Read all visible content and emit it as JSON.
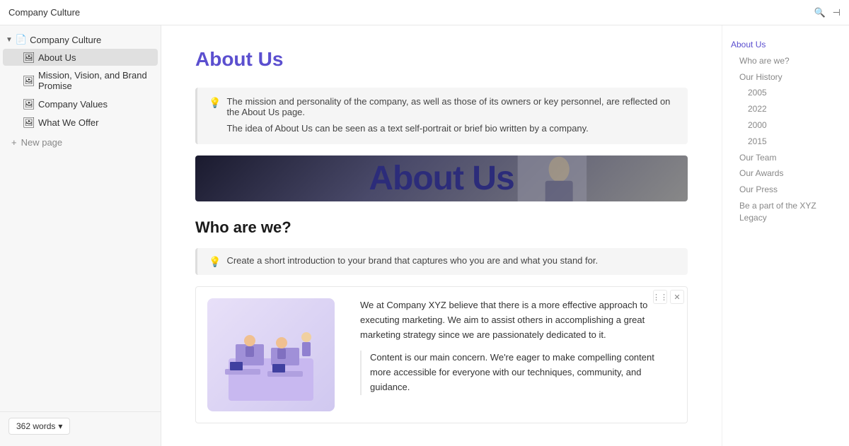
{
  "app": {
    "title": "Company Culture"
  },
  "topbar": {
    "title": "Company Culture",
    "search_icon": "🔍",
    "menu_icon": "≡"
  },
  "sidebar": {
    "root_label": "Company Culture",
    "items": [
      {
        "label": "About Us",
        "icon": "🖼",
        "active": true
      },
      {
        "label": "Mission, Vision, and Brand Promise",
        "icon": "🖼",
        "active": false
      },
      {
        "label": "Company Values",
        "icon": "🖼",
        "active": false
      },
      {
        "label": "What We Offer",
        "icon": "🖼",
        "active": false
      }
    ],
    "new_page_label": "New page",
    "word_count": "362 words"
  },
  "toc": {
    "items": [
      {
        "label": "About Us",
        "active": true,
        "indent": 0
      },
      {
        "label": "Who are we?",
        "active": false,
        "indent": 1
      },
      {
        "label": "Our History",
        "active": false,
        "indent": 1
      },
      {
        "label": "2005",
        "active": false,
        "indent": 2
      },
      {
        "label": "2022",
        "active": false,
        "indent": 2
      },
      {
        "label": "2000",
        "active": false,
        "indent": 2
      },
      {
        "label": "2015",
        "active": false,
        "indent": 2
      },
      {
        "label": "Our Team",
        "active": false,
        "indent": 1
      },
      {
        "label": "Our Awards",
        "active": false,
        "indent": 1
      },
      {
        "label": "Our Press",
        "active": false,
        "indent": 1
      },
      {
        "label": "Be a part of the XYZ Legacy",
        "active": false,
        "indent": 1
      }
    ]
  },
  "main": {
    "page_title": "About Us",
    "callout1": {
      "icon": "💡",
      "line1": "The mission and personality of the company, as well as those of its owners or key personnel, are reflected on the About Us page.",
      "line2": "The idea of About Us can be seen as a text self-portrait or brief bio written by a company."
    },
    "hero_text": "About Us",
    "section1": {
      "heading": "Who are we?",
      "callout_icon": "💡",
      "callout_text": "Create a short introduction to your brand that captures who you are and what you stand for."
    },
    "two_col": {
      "body1": "We at Company XYZ believe that there is a more effective approach to executing marketing. We aim to assist others in accomplishing a great marketing strategy since we are passionately dedicated to it.",
      "body2": "Content is our main concern. We're eager to make compelling content more accessible for everyone with our techniques, community, and guidance."
    }
  }
}
